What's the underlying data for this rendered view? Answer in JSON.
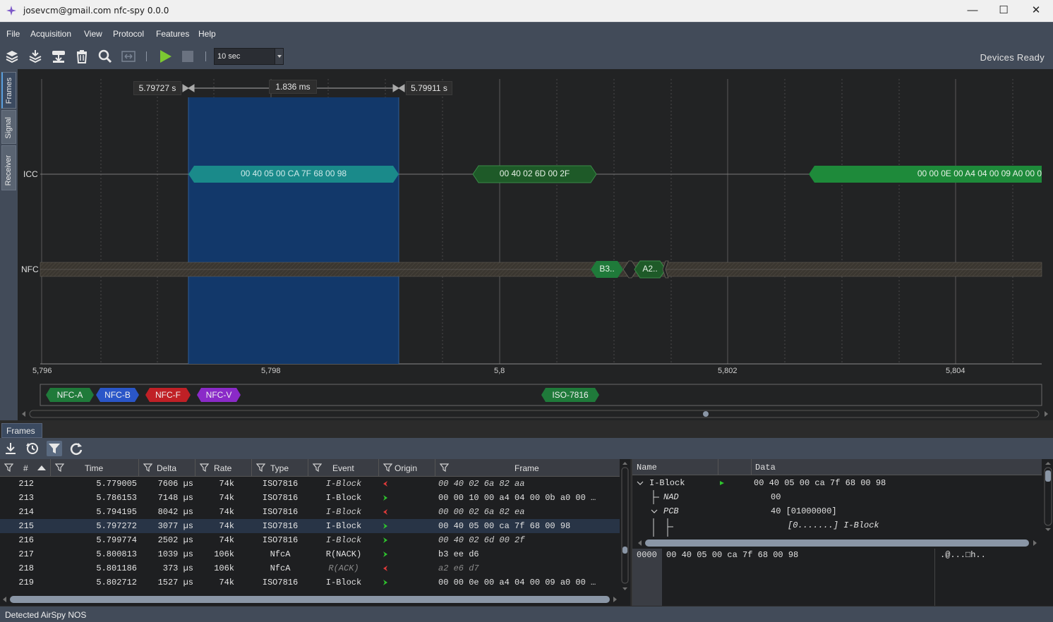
{
  "window": {
    "title": "josevcm@gmail.com nfc-spy 0.0.0",
    "minimize_icon": "minimize-icon",
    "maximize_icon": "maximize-icon",
    "close_icon": "close-icon"
  },
  "menu": {
    "items": [
      "File",
      "Acquisition",
      "View",
      "Protocol",
      "Features",
      "Help"
    ]
  },
  "toolbar": {
    "icons": [
      "stack-open-icon",
      "stack-save-icon",
      "record-download-icon",
      "trash-icon",
      "search-icon",
      "fit-range-icon",
      "play-icon",
      "stop-icon"
    ],
    "time_window": "10 sec",
    "device_status": "Devices Ready"
  },
  "side_tabs": [
    "Frames",
    "Signal",
    "Receiver"
  ],
  "timeline": {
    "lanes": [
      "ICC",
      "NFC"
    ],
    "axis_ticks": [
      "5,796",
      "5,798",
      "5,8",
      "5,802",
      "5,804"
    ],
    "marker_start": "5.79727 s",
    "marker_width": "1.836 ms",
    "marker_end": "5.79911 s",
    "icc_frames": [
      "00 40 05 00 CA 7F 68 00 98",
      "00 40 02 6D 00 2F",
      "00 00 0E 00 A4 04 00 09 A0 00 0"
    ],
    "nfc_frames": [
      "B3..",
      "A2.."
    ],
    "legend": [
      "NFC-A",
      "NFC-B",
      "NFC-F",
      "NFC-V",
      "ISO-7816"
    ],
    "colors": {
      "icc_selected": "#1a8a8a",
      "icc_frame": "#1e6e2e",
      "icc_frame_bright": "#1e8a3a",
      "selection": "#12386a",
      "nfc_a": "#1f7a3a",
      "nfc_b": "#2a56c8",
      "nfc_f": "#c02026",
      "nfc_v": "#8a2ac8",
      "iso7816": "#1f7a3a"
    }
  },
  "frames_panel": {
    "tab": "Frames",
    "toolbar_icons": [
      "download-icon",
      "clock-refresh-icon",
      "filter-icon",
      "reload-icon"
    ],
    "columns": [
      "#",
      "Time",
      "Delta",
      "Rate",
      "Type",
      "Event",
      "Origin",
      "Frame"
    ],
    "rows": [
      {
        "id": "212",
        "time": "5.779005",
        "delta": "7606 µs",
        "rate": "74k",
        "type": "ISO7816",
        "event": "I-Block",
        "origin": "rx",
        "frame": "00 40 02 6a 82 aa",
        "style": "italic"
      },
      {
        "id": "213",
        "time": "5.786153",
        "delta": "7148 µs",
        "rate": "74k",
        "type": "ISO7816",
        "event": "I-Block",
        "origin": "tx",
        "frame": "00 00 10 00 a4 04 00 0b a0 00 …",
        "style": "normal"
      },
      {
        "id": "214",
        "time": "5.794195",
        "delta": "8042 µs",
        "rate": "74k",
        "type": "ISO7816",
        "event": "I-Block",
        "origin": "rx",
        "frame": "00 00 02 6a 82 ea",
        "style": "italic"
      },
      {
        "id": "215",
        "time": "5.797272",
        "delta": "3077 µs",
        "rate": "74k",
        "type": "ISO7816",
        "event": "I-Block",
        "origin": "tx",
        "frame": "00 40 05 00 ca 7f 68 00 98",
        "style": "normal"
      },
      {
        "id": "216",
        "time": "5.799774",
        "delta": "2502 µs",
        "rate": "74k",
        "type": "ISO7816",
        "event": "I-Block",
        "origin": "tx",
        "frame": "00 40 02 6d 00 2f",
        "style": "italic"
      },
      {
        "id": "217",
        "time": "5.800813",
        "delta": "1039 µs",
        "rate": "106k",
        "type": "NfcA",
        "event": "R(NACK)",
        "origin": "tx",
        "frame": "b3 ee d6",
        "style": "normal"
      },
      {
        "id": "218",
        "time": "5.801186",
        "delta": "373 µs",
        "rate": "106k",
        "type": "NfcA",
        "event": "R(ACK)",
        "origin": "rx",
        "frame": "a2 e6 d7",
        "style": "dim"
      },
      {
        "id": "219",
        "time": "5.802712",
        "delta": "1527 µs",
        "rate": "74k",
        "type": "ISO7816",
        "event": "I-Block",
        "origin": "tx",
        "frame": "00 00 0e 00 a4 04 00 09 a0 00 …",
        "style": "normal"
      }
    ]
  },
  "detail": {
    "columns": [
      "Name",
      "Data"
    ],
    "tree": [
      {
        "name": "I-Block",
        "data": "00 40 05 00 ca 7f 68 00 98"
      },
      {
        "name": "NAD",
        "data": "00"
      },
      {
        "name": "PCB",
        "data": "40 [01000000]"
      },
      {
        "name": "",
        "data": "[0.......] I-Block"
      }
    ],
    "hex_offset": "0000",
    "hex_bytes": "00 40 05 00 ca 7f 68 00 98",
    "hex_ascii": ".@...□h.."
  },
  "status_bar": "Detected AirSpy NOS"
}
